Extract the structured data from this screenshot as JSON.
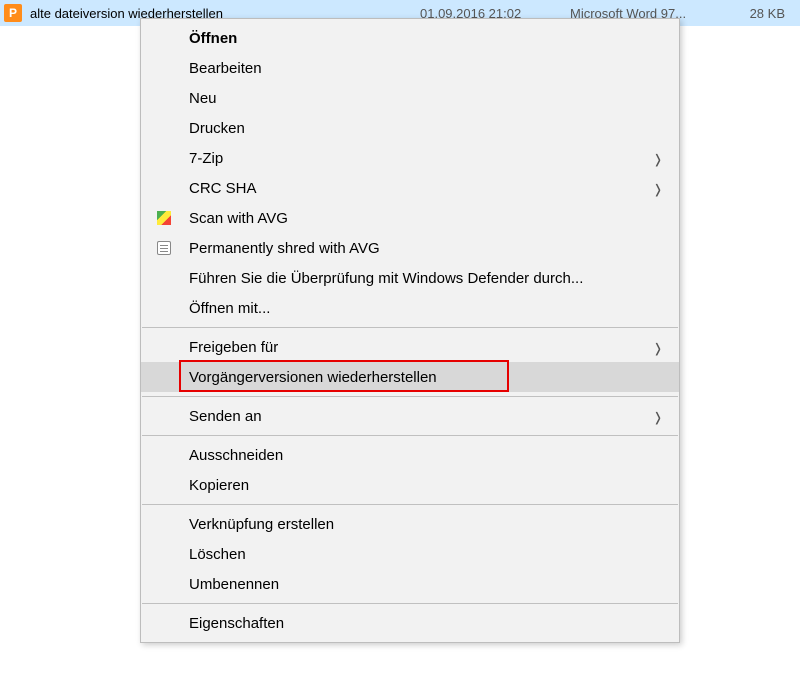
{
  "file": {
    "name": "alte dateiversion wiederherstellen",
    "date": "01.09.2016  21:02",
    "type": "Microsoft Word 97...",
    "size": "28 KB",
    "icon_letter": "P"
  },
  "menu": {
    "items": [
      {
        "label": "Öffnen",
        "bold": true
      },
      {
        "label": "Bearbeiten"
      },
      {
        "label": "Neu"
      },
      {
        "label": "Drucken"
      },
      {
        "label": "7-Zip",
        "submenu": true
      },
      {
        "label": "CRC SHA",
        "submenu": true
      },
      {
        "label": "Scan with AVG",
        "icon": "avg"
      },
      {
        "label": "Permanently shred with AVG",
        "icon": "shred"
      },
      {
        "label": "Führen Sie die Überprüfung mit Windows Defender durch..."
      },
      {
        "label": "Öffnen mit..."
      },
      {
        "separator": true
      },
      {
        "label": "Freigeben für",
        "submenu": true
      },
      {
        "label": "Vorgängerversionen wiederherstellen",
        "highlighted": true,
        "red_box": true
      },
      {
        "separator": true
      },
      {
        "label": "Senden an",
        "submenu": true
      },
      {
        "separator": true
      },
      {
        "label": "Ausschneiden"
      },
      {
        "label": "Kopieren"
      },
      {
        "separator": true
      },
      {
        "label": "Verknüpfung erstellen"
      },
      {
        "label": "Löschen"
      },
      {
        "label": "Umbenennen"
      },
      {
        "separator": true
      },
      {
        "label": "Eigenschaften"
      }
    ]
  }
}
